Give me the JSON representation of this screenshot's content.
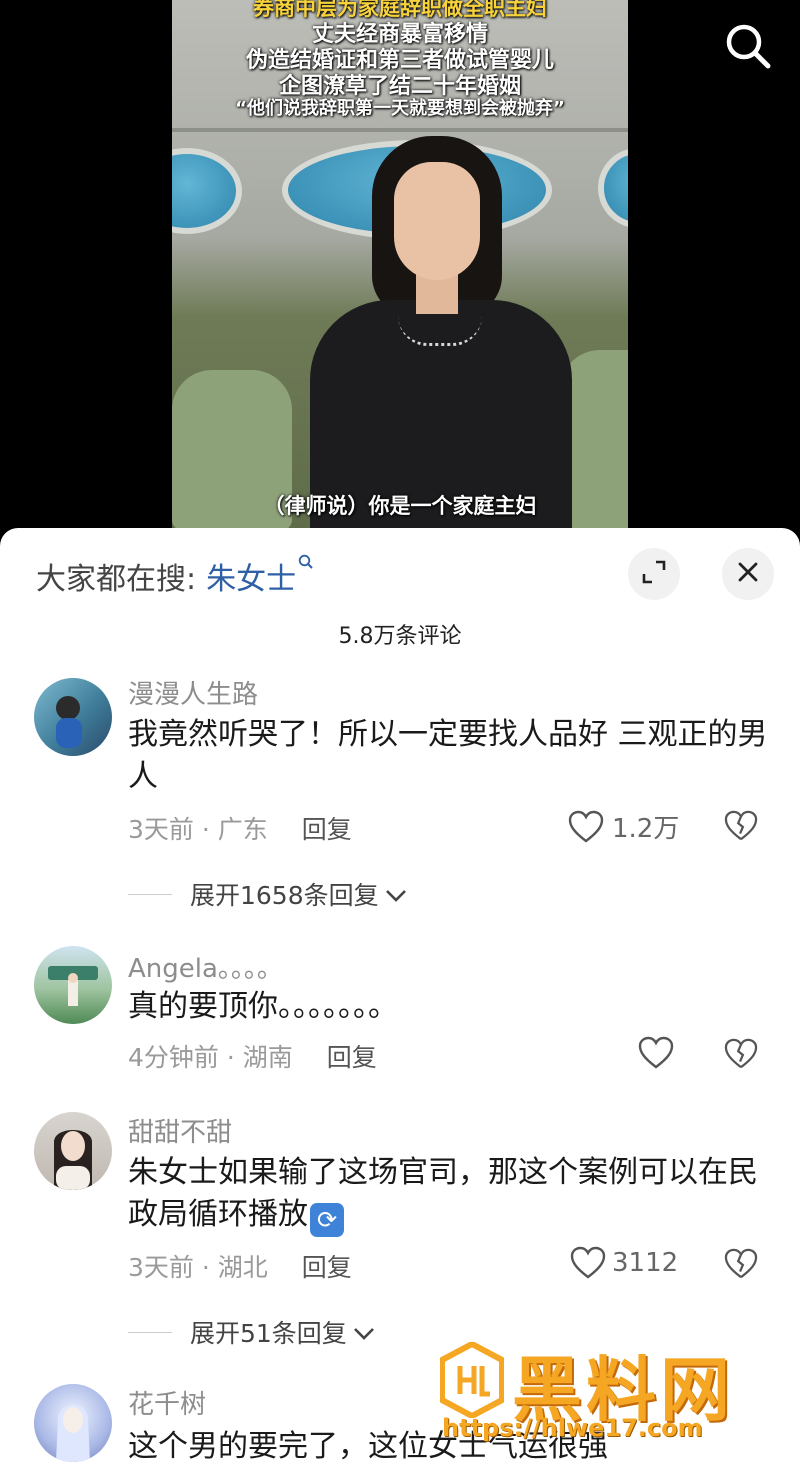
{
  "video": {
    "captions": [
      "券商中层为家庭辞职做全职主妇",
      "丈夫经商暴富移情",
      "伪造结婚证和第三者做试管婴儿",
      "企图潦草了结二十年婚姻",
      "“他们说我辞职第一天就要想到会被抛弃”"
    ],
    "subtitle": "（律师说）你是一个家庭主妇",
    "search_icon": "search-icon"
  },
  "sheet": {
    "hot_search_label": "大家都在搜:",
    "hot_search_term": "朱女士",
    "expand_icon": "expand-icon",
    "close_icon": "close-icon",
    "comment_count": "5.8万条评论"
  },
  "comments": [
    {
      "user": "漫漫人生路",
      "text": "我竟然听哭了！所以一定要找人品好  三观正的男人",
      "time": "3天前",
      "location": "广东",
      "reply_label": "回复",
      "likes": "1.2万",
      "expand": "展开1658条回复"
    },
    {
      "user": "Angela。。。。",
      "text": "真的要顶你。。。。。。。",
      "time": "4分钟前",
      "location": "湖南",
      "reply_label": "回复",
      "likes": ""
    },
    {
      "user": "甜甜不甜",
      "text": "朱女士如果输了这场官司，那这个案例可以在民政局循环播放",
      "time": "3天前",
      "location": "湖北",
      "reply_label": "回复",
      "likes": "3112",
      "expand": "展开51条回复"
    },
    {
      "user": "花千树",
      "text": "这个男的要完了，这位女士气运很强"
    }
  ],
  "watermark": {
    "title": "黑料网",
    "url": "https://hlwe17.com"
  },
  "colors": {
    "caption_yellow": "#f7d23a",
    "hot_search_blue": "#2f5fa5",
    "watermark_orange": "#f5a623"
  }
}
